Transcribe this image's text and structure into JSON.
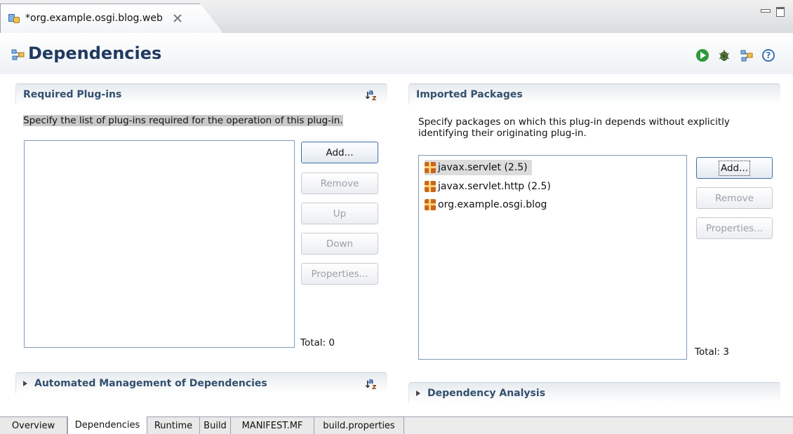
{
  "editor": {
    "tab_title": "*org.example.osgi.blog.web"
  },
  "header": {
    "title": "Dependencies"
  },
  "required_plugins": {
    "title": "Required Plug-ins",
    "description": "Specify the list of plug-ins required for the operation of this plug-in.",
    "items": [],
    "buttons": {
      "add": "Add...",
      "remove": "Remove",
      "up": "Up",
      "down": "Down",
      "properties": "Properties..."
    },
    "total": "Total: 0"
  },
  "imported_packages": {
    "title": "Imported Packages",
    "description_line1": "Specify packages on which this plug-in depends without explicitly",
    "description_line2": "identifying their originating plug-in.",
    "items": [
      {
        "label": "javax.servlet (2.5)",
        "selected": true
      },
      {
        "label": "javax.servlet.http (2.5)",
        "selected": false
      },
      {
        "label": "org.example.osgi.blog",
        "selected": false
      }
    ],
    "buttons": {
      "add": "Add...",
      "remove": "Remove",
      "properties": "Properties..."
    },
    "total": "Total: 3"
  },
  "automated_management": {
    "title": "Automated Management of Dependencies"
  },
  "dependency_analysis": {
    "title": "Dependency Analysis"
  },
  "page_tabs": [
    {
      "label": "Overview",
      "active": false
    },
    {
      "label": "Dependencies",
      "active": true
    },
    {
      "label": "Runtime",
      "active": false
    },
    {
      "label": "Build",
      "active": false
    },
    {
      "label": "MANIFEST.MF",
      "active": false
    },
    {
      "label": "build.properties",
      "active": false
    }
  ]
}
